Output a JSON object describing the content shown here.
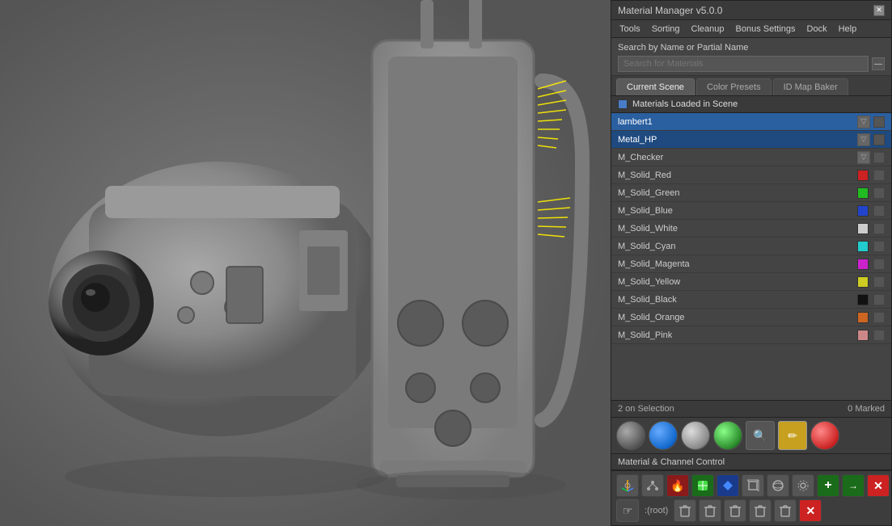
{
  "title": "Material Manager v5.0.0",
  "menu": {
    "items": [
      "Tools",
      "Sorting",
      "Cleanup",
      "Bonus Settings",
      "Dock",
      "Help"
    ]
  },
  "search": {
    "label": "Search by Name or Partial Name",
    "placeholder": "Search for Materials"
  },
  "tabs": [
    {
      "label": "Current Scene",
      "active": true
    },
    {
      "label": "Color Presets",
      "active": false
    },
    {
      "label": "ID Map Baker",
      "active": false
    }
  ],
  "materials_header": {
    "label": "Materials Loaded in Scene"
  },
  "materials": [
    {
      "name": "lambert1",
      "color": null,
      "selected": true,
      "selected_class": "selected"
    },
    {
      "name": "Metal_HP",
      "color": null,
      "selected": true,
      "selected_class": "selected2"
    },
    {
      "name": "M_Checker",
      "color": null,
      "selected": false
    },
    {
      "name": "M_Solid_Red",
      "color": "#cc2222",
      "selected": false
    },
    {
      "name": "M_Solid_Green",
      "color": "#22bb22",
      "selected": false
    },
    {
      "name": "M_Solid_Blue",
      "color": "#2244cc",
      "selected": false
    },
    {
      "name": "M_Solid_White",
      "color": "#cccccc",
      "selected": false
    },
    {
      "name": "M_Solid_Cyan",
      "color": "#22cccc",
      "selected": false
    },
    {
      "name": "M_Solid_Magenta",
      "color": "#cc22cc",
      "selected": false
    },
    {
      "name": "M_Solid_Yellow",
      "color": "#cccc22",
      "selected": false
    },
    {
      "name": "M_Solid_Black",
      "color": "#111111",
      "selected": false
    },
    {
      "name": "M_Solid_Orange",
      "color": "#cc6622",
      "selected": false
    },
    {
      "name": "M_Solid_Pink",
      "color": "#cc8888",
      "selected": false
    }
  ],
  "status": {
    "selection_text": "2  on Selection",
    "marked_text": "0  Marked"
  },
  "channel_control": {
    "label": "Material & Channel Control"
  },
  "preview_spheres": [
    {
      "type": "gray",
      "label": "gray-sphere"
    },
    {
      "type": "blue-gradient",
      "label": "blue-sphere"
    },
    {
      "type": "silver",
      "label": "silver-sphere"
    },
    {
      "type": "green",
      "label": "green-sphere"
    },
    {
      "type": "search",
      "label": "search-icon"
    },
    {
      "type": "pencil",
      "label": "pencil-icon"
    },
    {
      "type": "red",
      "label": "red-sphere"
    }
  ],
  "bottom_toolbar": {
    "row1_icons": [
      "cube-icon",
      "network-icon",
      "flame-icon",
      "box-icon",
      "diamond-icon",
      "cube-wire-icon",
      "sphere-wire-icon",
      "gear-icon",
      "plus-green-icon",
      "arrow-green-icon",
      "x-red-icon"
    ],
    "row2_icons": [
      "hand-icon",
      "root-label",
      "trash-icon",
      "trash-icon",
      "trash-icon",
      "trash-icon",
      "trash-icon",
      "x-red-icon"
    ],
    "root_label": ":(root)"
  }
}
